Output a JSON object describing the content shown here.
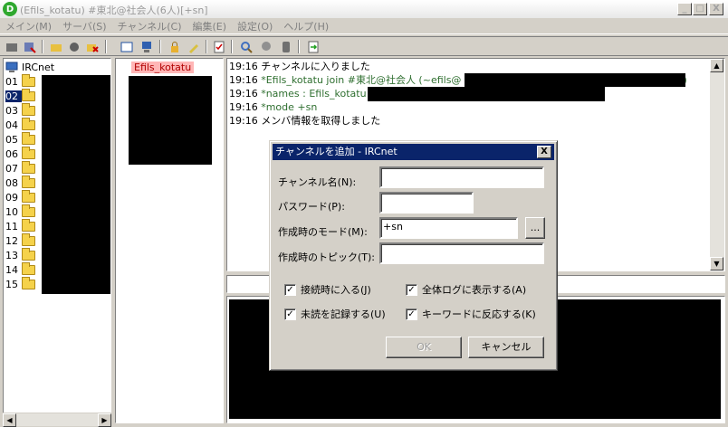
{
  "window": {
    "title": "(Efils_kotatu) #東北@社会人(6人)[+sn]",
    "app_icon": "D",
    "controls": {
      "minimize": "_",
      "maximize": "□",
      "close": "X"
    }
  },
  "menu": [
    "メイン(M)",
    "サーバ(S)",
    "チャンネル(C)",
    "編集(E)",
    "設定(O)",
    "ヘルプ(H)"
  ],
  "channel_tree": {
    "root": "IRCnet",
    "items": [
      "01",
      "02",
      "03",
      "04",
      "05",
      "06",
      "07",
      "08",
      "09",
      "10",
      "11",
      "12",
      "13",
      "14",
      "15"
    ],
    "selected": "02"
  },
  "nick_list": {
    "nicks": [
      "Efils_kotatu"
    ]
  },
  "log": [
    {
      "time": "19:16",
      "text": "チャンネルに入りました",
      "kind": "normal"
    },
    {
      "time": "19:16",
      "text": "*Efils_kotatu join #東北@社会人 (~efils@",
      "kind": "sys",
      "tail": ")"
    },
    {
      "time": "19:16",
      "text": "*names : Efils_kotatu",
      "kind": "sys"
    },
    {
      "time": "19:16",
      "text": "*mode +sn",
      "kind": "sys"
    },
    {
      "time": "19:16",
      "text": "メンバ情報を取得しました",
      "kind": "normal"
    }
  ],
  "dialog": {
    "title": "チャンネルを追加 - IRCnet",
    "close": "X",
    "fields": {
      "channel_name": {
        "label": "チャンネル名(N):",
        "value": ""
      },
      "password": {
        "label": "パスワード(P):",
        "value": ""
      },
      "mode": {
        "label": "作成時のモード(M):",
        "value": "+sn",
        "browse": "..."
      },
      "topic": {
        "label": "作成時のトピック(T):",
        "value": ""
      }
    },
    "checkboxes": [
      {
        "label": "接続時に入る(J)",
        "checked": true
      },
      {
        "label": "全体ログに表示する(A)",
        "checked": true
      },
      {
        "label": "未読を記録する(U)",
        "checked": true
      },
      {
        "label": "キーワードに反応する(K)",
        "checked": true
      }
    ],
    "ok_label": "OK",
    "cancel_label": "キャンセル"
  },
  "colors": {
    "selection": "#0a246a",
    "nick_highlight": "#ffb6b6",
    "system_text": "#2f6f30"
  }
}
